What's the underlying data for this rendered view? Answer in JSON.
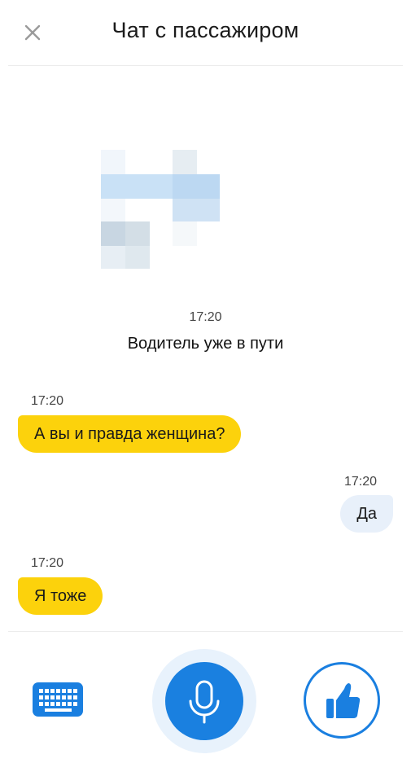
{
  "header": {
    "title": "Чат с пассажиром",
    "close_icon": "close-icon"
  },
  "system_message": {
    "time": "17:20",
    "text": "Водитель уже в пути",
    "image": "pixelated-avatar-image"
  },
  "messages": [
    {
      "side": "incoming",
      "time": "17:20",
      "text": "А вы и правда женщина?"
    },
    {
      "side": "outgoing",
      "time": "17:20",
      "text": "Да"
    },
    {
      "side": "incoming",
      "time": "17:20",
      "text": "Я тоже"
    }
  ],
  "footer": {
    "keyboard_icon": "keyboard-icon",
    "mic_icon": "microphone-icon",
    "like_icon": "thumbs-up-icon"
  },
  "colors": {
    "incoming_bubble": "#fcd20c",
    "outgoing_bubble": "#e8f0fa",
    "accent_blue": "#1a80e0"
  }
}
